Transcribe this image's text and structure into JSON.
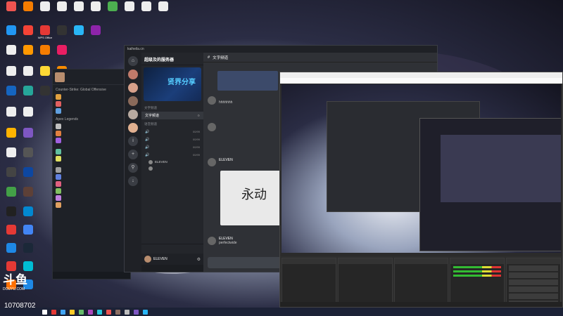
{
  "desktop": {
    "icons": [
      {
        "label": "",
        "color": "#1e88e5"
      },
      {
        "label": "",
        "color": "#f57c00"
      },
      {
        "label": "",
        "color": "#eeeeee"
      },
      {
        "label": "",
        "color": "#eeeeee"
      },
      {
        "label": "",
        "color": "#eeeeee"
      },
      {
        "label": "",
        "color": "#eeeeee"
      },
      {
        "label": "",
        "color": "#4caf50"
      },
      {
        "label": "",
        "color": "#eeeeee"
      },
      {
        "label": "",
        "color": "#eeeeee"
      },
      {
        "label": "",
        "color": "#eeeeee"
      },
      {
        "label": "",
        "color": "#2196f3"
      },
      {
        "label": "",
        "color": "#f44336"
      },
      {
        "label": "",
        "color": "#eeeeee"
      },
      {
        "label": "",
        "color": "#ff9800"
      },
      {
        "label": "",
        "color": "#eeeeee"
      },
      {
        "label": "",
        "color": "#eeeeee"
      },
      {
        "label": "",
        "color": "#1565c0"
      },
      {
        "label": "",
        "color": "#26a69a"
      },
      {
        "label": "",
        "color": "#eeeeee"
      },
      {
        "label": "",
        "color": "#eeeeee"
      },
      {
        "label": "",
        "color": "#ffb300"
      },
      {
        "label": "",
        "color": "#7e57c2"
      },
      {
        "label": "",
        "color": "#eeeeee"
      },
      {
        "label": "",
        "color": "#555555"
      },
      {
        "label": "",
        "color": "#444444"
      },
      {
        "label": "",
        "color": "#0d47a1"
      },
      {
        "label": "",
        "color": "#43a047"
      },
      {
        "label": "",
        "color": "#5d4037"
      },
      {
        "label": "",
        "color": "#212121"
      },
      {
        "label": "",
        "color": "#0288d1"
      },
      {
        "label": "",
        "color": "#e53935"
      },
      {
        "label": "",
        "color": "#4285f4"
      },
      {
        "label": "",
        "color": "#1e88e5"
      },
      {
        "label": "",
        "color": "#1b2838"
      },
      {
        "label": "",
        "color": "#e53935"
      },
      {
        "label": "",
        "color": "#00bcd4"
      },
      {
        "label": "",
        "color": "#ff6f00"
      },
      {
        "label": "",
        "color": "#1e88e5"
      },
      {
        "label": "WPS Office",
        "color": "#e53935"
      },
      {
        "label": "",
        "color": "#333333"
      },
      {
        "label": "",
        "color": "#29b6f6"
      },
      {
        "label": "",
        "color": "#8e24aa"
      },
      {
        "label": "",
        "color": "#f57c00"
      },
      {
        "label": "",
        "color": "#e91e63"
      },
      {
        "label": "",
        "color": "#fdd835"
      },
      {
        "label": "",
        "color": "#fb8c00"
      },
      {
        "label": "",
        "color": "#333333"
      },
      {
        "label": "",
        "color": "#ffca28"
      },
      {
        "label": "",
        "color": "#ef5350"
      }
    ],
    "douyu_logo": "斗鱼",
    "douyu_sub": "DOUYU.COM",
    "room_id": "10708702"
  },
  "friends_panel": {
    "user_name": "",
    "groups": [
      {
        "title": "Counter-Strike: Global Offensive",
        "rows": [
          {
            "name": "",
            "color": "#e0a040"
          },
          {
            "name": "",
            "color": "#e06060"
          },
          {
            "name": "",
            "color": "#60a0e0"
          }
        ]
      },
      {
        "title": "Apex Legends",
        "rows": [
          {
            "name": "",
            "color": "#c0c0c0"
          },
          {
            "name": "",
            "color": "#e08040"
          },
          {
            "name": "",
            "color": "#a060e0"
          }
        ]
      },
      {
        "title": "",
        "rows": [
          {
            "name": "",
            "color": "#60c0a0"
          },
          {
            "name": "",
            "color": "#e0e060"
          }
        ]
      },
      {
        "title": "",
        "rows": [
          {
            "name": "",
            "color": "#a0a0a0"
          },
          {
            "name": "",
            "color": "#6080e0"
          },
          {
            "name": "",
            "color": "#e06080"
          },
          {
            "name": "",
            "color": "#80c060"
          },
          {
            "name": "",
            "color": "#c080e0"
          },
          {
            "name": "",
            "color": "#e0a060"
          }
        ]
      }
    ],
    "footer": ""
  },
  "kook": {
    "titlebar_url": "kaiheila.cn",
    "server_name": "超级及的服务器",
    "banner_title": "贤界分享",
    "banner_sub": "",
    "channel_categories": [
      "文字频道",
      "语音频道"
    ],
    "text_channels": [
      {
        "name": "文字频道",
        "count": ""
      }
    ],
    "voice_channels": [
      {
        "name": "",
        "count": "00/99"
      },
      {
        "name": "",
        "count": "00/99"
      },
      {
        "name": "",
        "count": "00/99"
      },
      {
        "name": "",
        "count": "00/99"
      }
    ],
    "voice_users": [
      "ELEVEN",
      ""
    ],
    "voice_status": "",
    "me_name": "ELEVEN",
    "me_tag": "",
    "bottom_text": "",
    "chat_title": "文字频道",
    "messages": [
      {
        "name": "",
        "time": "",
        "lines": [
          "hhhhhhh",
          "",
          "",
          ""
        ]
      },
      {
        "name": "",
        "time": "",
        "lines": [
          "",
          "",
          "",
          ""
        ]
      },
      {
        "name": "ELEVEN",
        "time": "",
        "lines": []
      },
      {
        "name": "ELEVEN",
        "time": "",
        "lines": [
          "perfectwide"
        ]
      }
    ],
    "image_text": "永动",
    "input_placeholder": ""
  },
  "obs": {
    "window_title": "",
    "menu": [
      "",
      "",
      "",
      "",
      "",
      "",
      ""
    ],
    "docks": [
      {
        "title": "",
        "items": []
      },
      {
        "title": "",
        "items": []
      },
      {
        "title": "",
        "items": []
      },
      {
        "title": "",
        "items": []
      },
      {
        "title": "",
        "items": [
          "",
          "",
          "",
          "",
          "",
          ""
        ]
      }
    ],
    "status": ""
  },
  "taskbar": {
    "icons": [
      "#ffffff",
      "#e53935",
      "#42a5f5",
      "#ffca28",
      "#66bb6a",
      "#ab47bc",
      "#26c6da",
      "#ef5350",
      "#8d6e63",
      "#bdbdbd",
      "#7e57c2",
      "#29b6f6"
    ],
    "time": "",
    "date": ""
  }
}
